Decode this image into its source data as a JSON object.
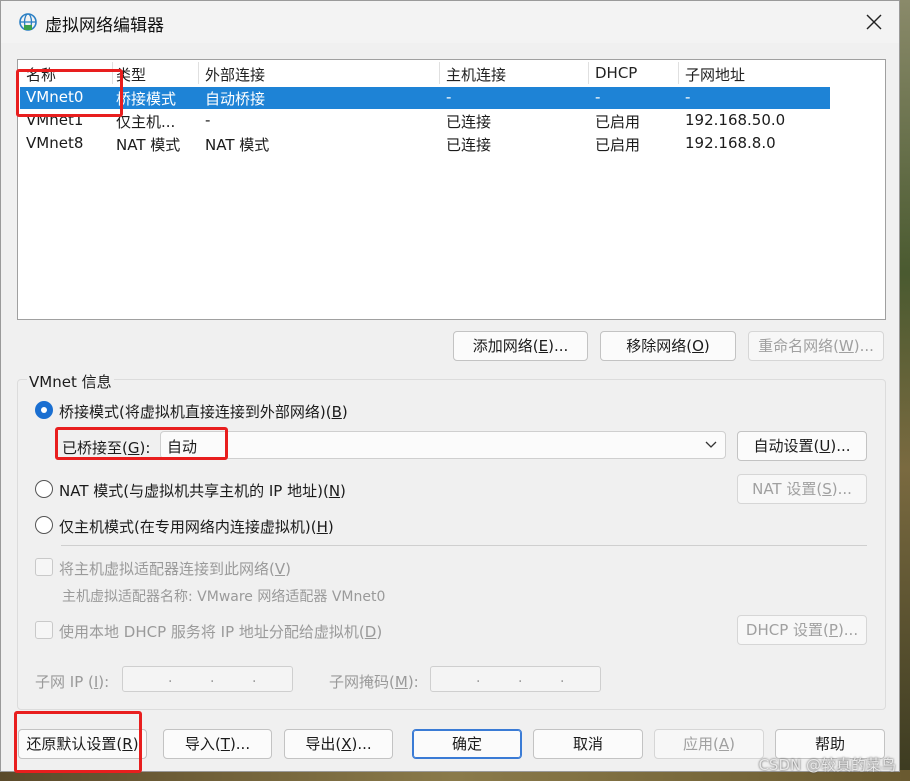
{
  "window": {
    "title": "虚拟网络编辑器",
    "close_label": "✕"
  },
  "list": {
    "headers": [
      "名称",
      "类型",
      "外部连接",
      "主机连接",
      "DHCP",
      "子网地址"
    ],
    "rows": [
      {
        "name": "VMnet0",
        "type": "桥接模式",
        "external": "自动桥接",
        "host": "-",
        "dhcp": "-",
        "subnet": "-",
        "selected": true
      },
      {
        "name": "VMnet1",
        "type": "仅主机...",
        "external": "-",
        "host": "已连接",
        "dhcp": "已启用",
        "subnet": "192.168.50.0",
        "selected": false
      },
      {
        "name": "VMnet8",
        "type": "NAT 模式",
        "external": "NAT 模式",
        "host": "已连接",
        "dhcp": "已启用",
        "subnet": "192.168.8.0",
        "selected": false
      }
    ]
  },
  "list_buttons": {
    "add": {
      "text": "添加网络(",
      "key": "E",
      "tail": ")..."
    },
    "remove": {
      "text": "移除网络(",
      "key": "O",
      "tail": ")"
    },
    "rename": {
      "text": "重命名网络(",
      "key": "W",
      "tail": ")..."
    }
  },
  "vmnet_info": {
    "group_label": "VMnet 信息",
    "bridged": {
      "text": "桥接模式(将虚拟机直接连接到外部网络)(",
      "key": "B",
      "tail": ")",
      "checked": true
    },
    "bridged_to": {
      "text": "已桥接至(",
      "key": "G",
      "tail": "):",
      "value": "自动"
    },
    "auto_settings": {
      "text": "自动设置(",
      "key": "U",
      "tail": ")..."
    },
    "nat": {
      "text": "NAT 模式(与虚拟机共享主机的 IP 地址)(",
      "key": "N",
      "tail": ")",
      "checked": false
    },
    "nat_settings": {
      "text": "NAT 设置(",
      "key": "S",
      "tail": ")..."
    },
    "host_only": {
      "text": "仅主机模式(在专用网络内连接虚拟机)(",
      "key": "H",
      "tail": ")",
      "checked": false
    },
    "connect_adapter": {
      "text": "将主机虚拟适配器连接到此网络(",
      "key": "V",
      "tail": ")"
    },
    "adapter_name": "主机虚拟适配器名称: VMware 网络适配器 VMnet0",
    "use_dhcp": {
      "text": "使用本地 DHCP 服务将 IP 地址分配给虚拟机(",
      "key": "D",
      "tail": ")"
    },
    "dhcp_settings": {
      "text": "DHCP 设置(",
      "key": "P",
      "tail": ")..."
    },
    "subnet_ip": {
      "text": "子网 IP (",
      "key": "I",
      "tail": "):"
    },
    "subnet_mask": {
      "text": "子网掩码(",
      "key": "M",
      "tail": "):"
    },
    "ip_dots": "."
  },
  "footer": {
    "restore": {
      "text": "还原默认设置(",
      "key": "R",
      "tail": ")"
    },
    "import": {
      "text": "导入(",
      "key": "T",
      "tail": ")..."
    },
    "export": {
      "text": "导出(",
      "key": "X",
      "tail": ")..."
    },
    "ok": "确定",
    "cancel": "取消",
    "apply": {
      "text": "应用(",
      "key": "A",
      "tail": ")"
    },
    "help": "帮助"
  },
  "watermark": "CSDN @较真的菜鸟",
  "colors": {
    "selection": "#1e83d6",
    "annotation": "#e81e1e",
    "radio_checked": "#1a6fd1"
  }
}
